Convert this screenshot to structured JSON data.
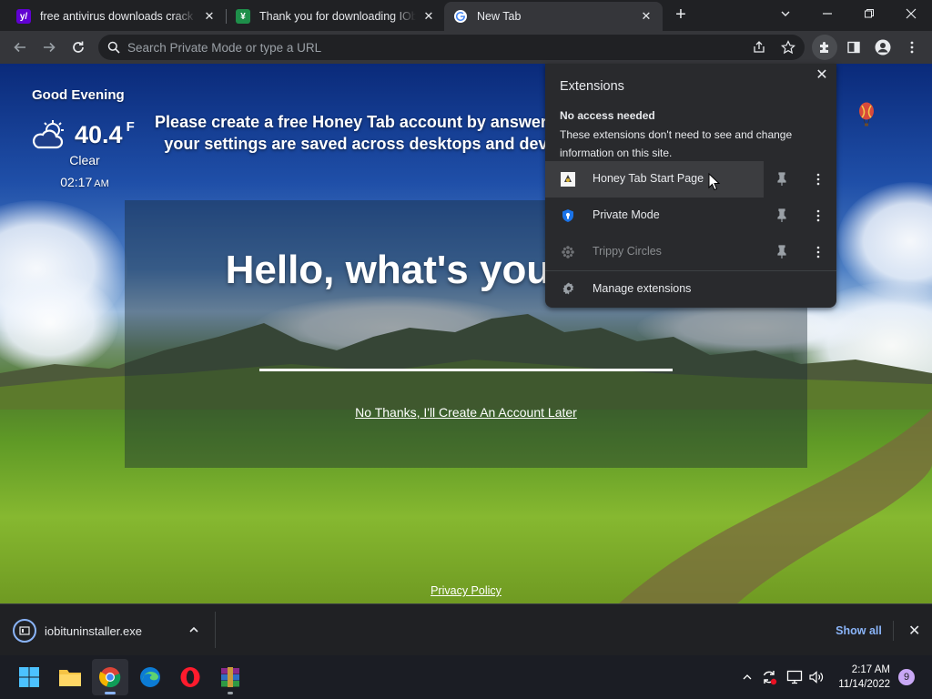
{
  "tabs": [
    {
      "title": "free antivirus downloads crack - Yahoo",
      "favicon": "yahoo-icon",
      "color": "#6001d2",
      "glyph": "y/"
    },
    {
      "title": "Thank you for downloading IObit Uninstaller",
      "favicon": "softpedia-icon",
      "color": "#1e8f4a",
      "glyph": "¥"
    },
    {
      "title": "New Tab",
      "favicon": "google-icon",
      "color": "#ffffff",
      "glyph": "G"
    }
  ],
  "toolbar": {
    "omnibox_placeholder": "Search Private Mode or type a URL"
  },
  "page": {
    "greeting": "Good Evening",
    "temperature": "40.4",
    "temperature_unit": "F",
    "condition": "Clear",
    "time": "02:17",
    "ampm": "AM",
    "headline": "Please create a free Honey Tab account by answering a few questions to ensure your settings are saved across desktops and devices for the best experience.",
    "hello": "Hello, what's your name?",
    "no_thanks": "No Thanks, I'll Create An Account Later",
    "privacy": "Privacy Policy"
  },
  "extensions": {
    "title": "Extensions",
    "subtitle": "No access needed",
    "description": "These extensions don't need to see and change information on this site.",
    "items": [
      {
        "label": "Honey Tab Start Page",
        "icon": "honey-tab-icon"
      },
      {
        "label": "Private Mode",
        "icon": "private-mode-icon"
      },
      {
        "label": "Trippy Circles",
        "icon": "trippy-circles-icon"
      }
    ],
    "manage": "Manage extensions"
  },
  "downloads": {
    "file": "iobituninstaller.exe",
    "show_all": "Show all"
  },
  "taskbar": {
    "time": "2:17 AM",
    "date": "11/14/2022",
    "notifications": "9"
  }
}
